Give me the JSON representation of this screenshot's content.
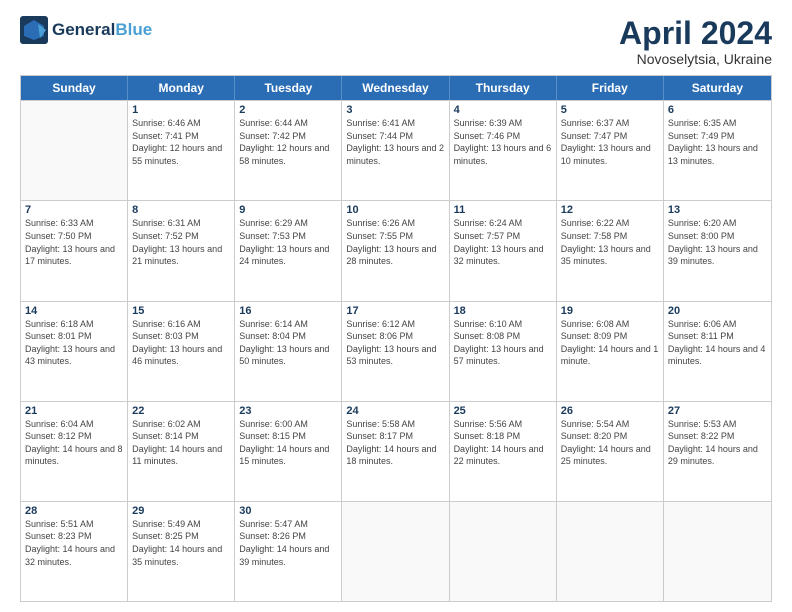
{
  "header": {
    "logo_line1": "General",
    "logo_line2": "Blue",
    "month": "April 2024",
    "location": "Novoselytsia, Ukraine"
  },
  "days_of_week": [
    "Sunday",
    "Monday",
    "Tuesday",
    "Wednesday",
    "Thursday",
    "Friday",
    "Saturday"
  ],
  "weeks": [
    [
      {
        "day": "",
        "empty": true
      },
      {
        "day": "1",
        "sunrise": "6:46 AM",
        "sunset": "7:41 PM",
        "daylight": "12 hours and 55 minutes."
      },
      {
        "day": "2",
        "sunrise": "6:44 AM",
        "sunset": "7:42 PM",
        "daylight": "12 hours and 58 minutes."
      },
      {
        "day": "3",
        "sunrise": "6:41 AM",
        "sunset": "7:44 PM",
        "daylight": "13 hours and 2 minutes."
      },
      {
        "day": "4",
        "sunrise": "6:39 AM",
        "sunset": "7:46 PM",
        "daylight": "13 hours and 6 minutes."
      },
      {
        "day": "5",
        "sunrise": "6:37 AM",
        "sunset": "7:47 PM",
        "daylight": "13 hours and 10 minutes."
      },
      {
        "day": "6",
        "sunrise": "6:35 AM",
        "sunset": "7:49 PM",
        "daylight": "13 hours and 13 minutes."
      }
    ],
    [
      {
        "day": "7",
        "sunrise": "6:33 AM",
        "sunset": "7:50 PM",
        "daylight": "13 hours and 17 minutes."
      },
      {
        "day": "8",
        "sunrise": "6:31 AM",
        "sunset": "7:52 PM",
        "daylight": "13 hours and 21 minutes."
      },
      {
        "day": "9",
        "sunrise": "6:29 AM",
        "sunset": "7:53 PM",
        "daylight": "13 hours and 24 minutes."
      },
      {
        "day": "10",
        "sunrise": "6:26 AM",
        "sunset": "7:55 PM",
        "daylight": "13 hours and 28 minutes."
      },
      {
        "day": "11",
        "sunrise": "6:24 AM",
        "sunset": "7:57 PM",
        "daylight": "13 hours and 32 minutes."
      },
      {
        "day": "12",
        "sunrise": "6:22 AM",
        "sunset": "7:58 PM",
        "daylight": "13 hours and 35 minutes."
      },
      {
        "day": "13",
        "sunrise": "6:20 AM",
        "sunset": "8:00 PM",
        "daylight": "13 hours and 39 minutes."
      }
    ],
    [
      {
        "day": "14",
        "sunrise": "6:18 AM",
        "sunset": "8:01 PM",
        "daylight": "13 hours and 43 minutes."
      },
      {
        "day": "15",
        "sunrise": "6:16 AM",
        "sunset": "8:03 PM",
        "daylight": "13 hours and 46 minutes."
      },
      {
        "day": "16",
        "sunrise": "6:14 AM",
        "sunset": "8:04 PM",
        "daylight": "13 hours and 50 minutes."
      },
      {
        "day": "17",
        "sunrise": "6:12 AM",
        "sunset": "8:06 PM",
        "daylight": "13 hours and 53 minutes."
      },
      {
        "day": "18",
        "sunrise": "6:10 AM",
        "sunset": "8:08 PM",
        "daylight": "13 hours and 57 minutes."
      },
      {
        "day": "19",
        "sunrise": "6:08 AM",
        "sunset": "8:09 PM",
        "daylight": "14 hours and 1 minute."
      },
      {
        "day": "20",
        "sunrise": "6:06 AM",
        "sunset": "8:11 PM",
        "daylight": "14 hours and 4 minutes."
      }
    ],
    [
      {
        "day": "21",
        "sunrise": "6:04 AM",
        "sunset": "8:12 PM",
        "daylight": "14 hours and 8 minutes."
      },
      {
        "day": "22",
        "sunrise": "6:02 AM",
        "sunset": "8:14 PM",
        "daylight": "14 hours and 11 minutes."
      },
      {
        "day": "23",
        "sunrise": "6:00 AM",
        "sunset": "8:15 PM",
        "daylight": "14 hours and 15 minutes."
      },
      {
        "day": "24",
        "sunrise": "5:58 AM",
        "sunset": "8:17 PM",
        "daylight": "14 hours and 18 minutes."
      },
      {
        "day": "25",
        "sunrise": "5:56 AM",
        "sunset": "8:18 PM",
        "daylight": "14 hours and 22 minutes."
      },
      {
        "day": "26",
        "sunrise": "5:54 AM",
        "sunset": "8:20 PM",
        "daylight": "14 hours and 25 minutes."
      },
      {
        "day": "27",
        "sunrise": "5:53 AM",
        "sunset": "8:22 PM",
        "daylight": "14 hours and 29 minutes."
      }
    ],
    [
      {
        "day": "28",
        "sunrise": "5:51 AM",
        "sunset": "8:23 PM",
        "daylight": "14 hours and 32 minutes."
      },
      {
        "day": "29",
        "sunrise": "5:49 AM",
        "sunset": "8:25 PM",
        "daylight": "14 hours and 35 minutes."
      },
      {
        "day": "30",
        "sunrise": "5:47 AM",
        "sunset": "8:26 PM",
        "daylight": "14 hours and 39 minutes."
      },
      {
        "day": "",
        "empty": true
      },
      {
        "day": "",
        "empty": true
      },
      {
        "day": "",
        "empty": true
      },
      {
        "day": "",
        "empty": true
      }
    ]
  ]
}
